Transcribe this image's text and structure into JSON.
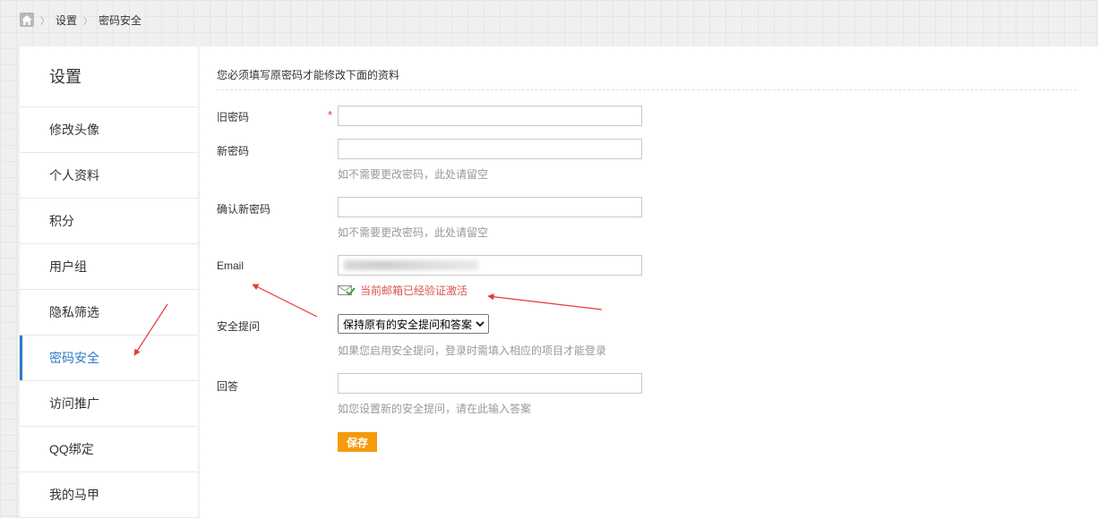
{
  "breadcrumb": {
    "home_icon": "home-icon",
    "items": [
      "设置",
      "密码安全"
    ]
  },
  "sidebar": {
    "title": "设置",
    "items": [
      {
        "label": "修改头像"
      },
      {
        "label": "个人资料"
      },
      {
        "label": "积分"
      },
      {
        "label": "用户组"
      },
      {
        "label": "隐私筛选"
      },
      {
        "label": "密码安全",
        "active": true
      },
      {
        "label": "访问推广"
      },
      {
        "label": "QQ绑定"
      },
      {
        "label": "我的马甲"
      }
    ]
  },
  "form": {
    "notice": "您必须填写原密码才能修改下面的资料",
    "required_mark": "*",
    "old_password": {
      "label": "旧密码",
      "value": ""
    },
    "new_password": {
      "label": "新密码",
      "value": "",
      "hint": "如不需要更改密码，此处请留空"
    },
    "confirm_password": {
      "label": "确认新密码",
      "value": "",
      "hint": "如不需要更改密码，此处请留空"
    },
    "email": {
      "label": "Email",
      "verified_text": "当前邮箱已经验证激活",
      "verified_icon": "envelope-check-icon"
    },
    "security_question": {
      "label": "安全提问",
      "selected": "保持原有的安全提问和答案",
      "hint": "如果您启用安全提问，登录时需填入相应的项目才能登录"
    },
    "answer": {
      "label": "回答",
      "value": "",
      "hint": "如您设置新的安全提问，请在此输入答案"
    },
    "save_label": "保存"
  },
  "colors": {
    "accent_blue": "#2b7acd",
    "save_orange": "#f59a0c",
    "annotation_red": "#e53935",
    "verified_red": "#d9534f"
  }
}
